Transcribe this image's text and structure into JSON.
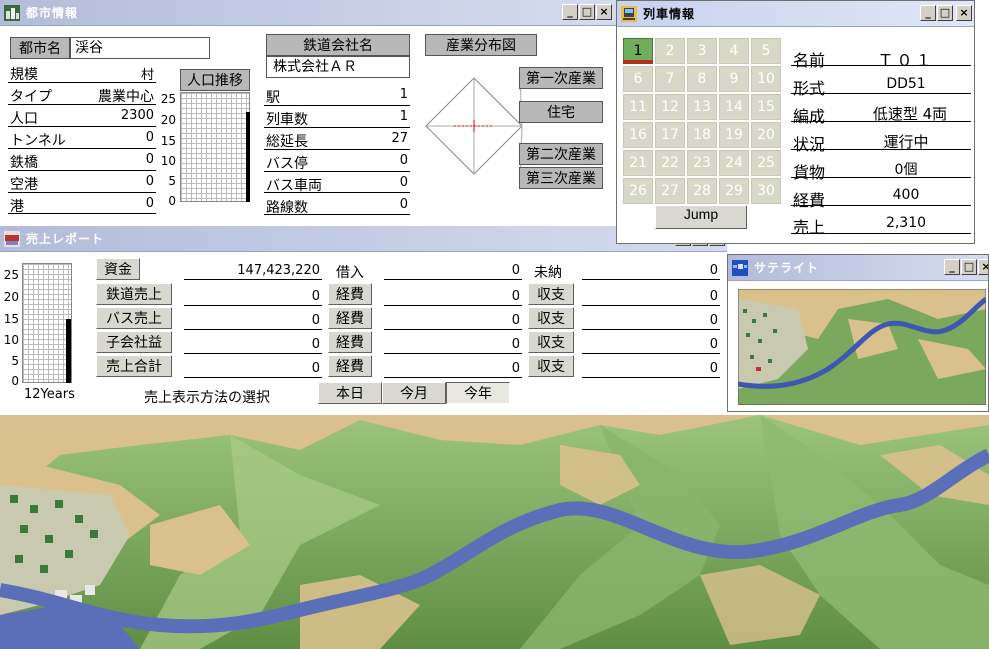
{
  "city_window": {
    "title": "都市情報",
    "city_name_label": "都市名",
    "city_name": "渓谷",
    "rows": [
      {
        "label": "規模",
        "value": "村"
      },
      {
        "label": "タイプ",
        "value": "農業中心"
      },
      {
        "label": "人口",
        "value": "2300"
      },
      {
        "label": "トンネル",
        "value": "0"
      },
      {
        "label": "鉄橋",
        "value": "0"
      },
      {
        "label": "空港",
        "value": "0"
      },
      {
        "label": "港",
        "value": "0"
      }
    ],
    "pop_chart": {
      "label": "人口推移",
      "ticks": [
        "25",
        "20",
        "15",
        "10",
        "5",
        "0"
      ]
    },
    "company_label": "鉄道会社名",
    "company_name": "株式会社ＡＲ",
    "stats": [
      {
        "label": "駅",
        "value": "1"
      },
      {
        "label": "列車数",
        "value": "1"
      },
      {
        "label": "総延長",
        "value": "27"
      },
      {
        "label": "バス停",
        "value": "0"
      },
      {
        "label": "バス車両",
        "value": "0"
      },
      {
        "label": "路線数",
        "value": "0"
      }
    ],
    "industry_label": "産業分布図",
    "industries": [
      "第一次産業",
      "住宅",
      "第二次産業",
      "第三次産業"
    ]
  },
  "train_window": {
    "title": "列車情報",
    "slots": [
      "1",
      "2",
      "3",
      "4",
      "5",
      "6",
      "7",
      "8",
      "9",
      "10",
      "11",
      "12",
      "13",
      "14",
      "15",
      "16",
      "17",
      "18",
      "19",
      "20",
      "21",
      "22",
      "23",
      "24",
      "25",
      "26",
      "27",
      "28",
      "29",
      "30"
    ],
    "selected_slot": "1",
    "jump_label": "Jump",
    "info": [
      {
        "label": "名前",
        "value": "Ｔ０１"
      },
      {
        "label": "形式",
        "value": "DD51"
      },
      {
        "label": "編成",
        "value": "低速型 4両"
      },
      {
        "label": "状況",
        "value": "運行中"
      },
      {
        "label": "貨物",
        "value": "0個"
      },
      {
        "label": "経費",
        "value": "400"
      },
      {
        "label": "売上",
        "value": "2,310"
      }
    ]
  },
  "sales_window": {
    "title": "売上レポート",
    "ticks": [
      "25",
      "20",
      "15",
      "10",
      "5",
      "0"
    ],
    "years_label": "12Years",
    "col1": [
      {
        "label": "資金",
        "value": "147,423,220"
      },
      {
        "label": "鉄道売上",
        "value": "0"
      },
      {
        "label": "バス売上",
        "value": "0"
      },
      {
        "label": "子会社益",
        "value": "0"
      },
      {
        "label": "売上合計",
        "value": "0"
      }
    ],
    "col2": [
      {
        "label": "借入",
        "value": "0"
      },
      {
        "label": "経費",
        "value": "0"
      },
      {
        "label": "経費",
        "value": "0"
      },
      {
        "label": "経費",
        "value": "0"
      },
      {
        "label": "経費",
        "value": "0"
      }
    ],
    "col3": [
      {
        "label": "未納",
        "value": "0"
      },
      {
        "label": "収支",
        "value": "0"
      },
      {
        "label": "収支",
        "value": "0"
      },
      {
        "label": "収支",
        "value": "0"
      },
      {
        "label": "収支",
        "value": "0"
      }
    ],
    "mode_label": "売上表示方法の選択",
    "modes": [
      "本日",
      "今月",
      "今年"
    ],
    "active_mode": "今年"
  },
  "satellite_window": {
    "title": "サテライト"
  },
  "colors": {
    "grass": "#7aa95e",
    "dirt": "#d9c08c",
    "river": "#5a6fb8",
    "selected_slot": "#6fae5a"
  }
}
